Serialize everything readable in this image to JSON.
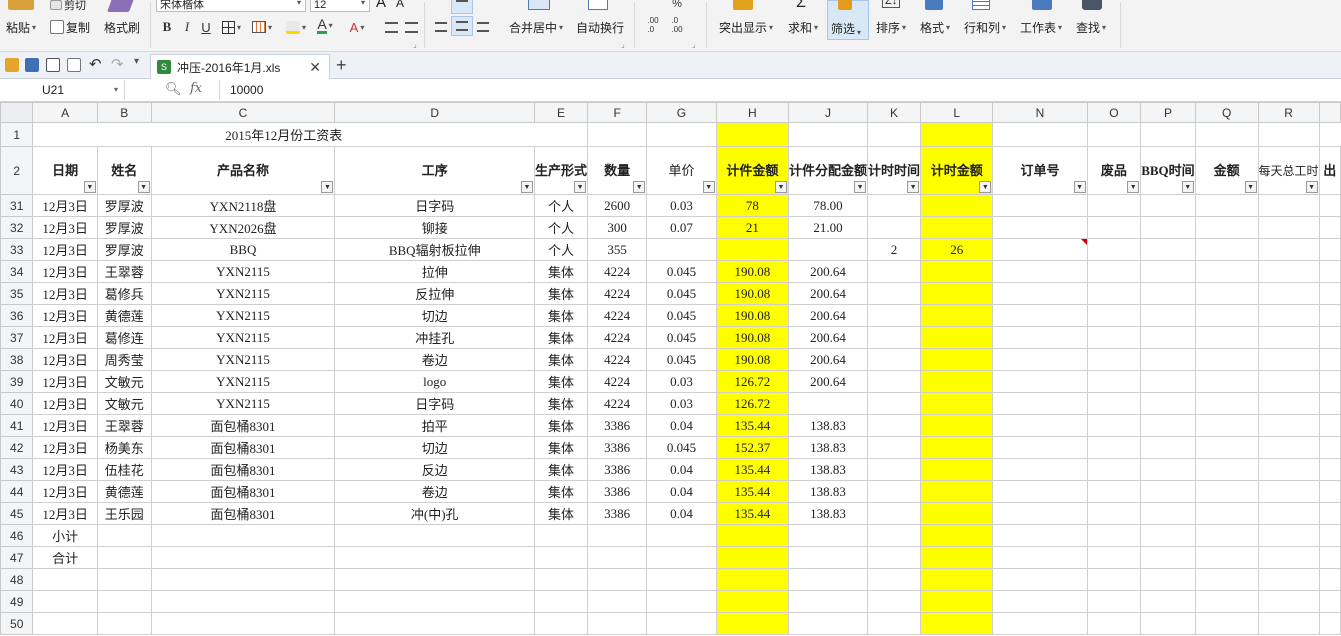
{
  "ribbon": {
    "paste": "粘贴",
    "paste_caret": "▾",
    "copy": "复制",
    "format_painter": "格式刷",
    "cut": "剪切",
    "font_name": "宋体楷体",
    "font_size": "12",
    "bold": "B",
    "italic": "I",
    "underline": "U",
    "font_grow": "A",
    "font_shrink": "A",
    "merge_center": "合并居中",
    "wrap_text": "自动换行",
    "highlight": "突出显示",
    "sum": "求和",
    "filter": "筛选",
    "sort": "排序",
    "format": "格式",
    "rows_cols": "行和列",
    "worksheet": "工作表",
    "find": "查找",
    "percent": "%",
    "decimal_inc": ".00\n.0",
    "decimal_dec": ".0\n.00",
    "dropdown_caret": "▾"
  },
  "tabbar": {
    "doc_name": "冲压-2016年1月.xls",
    "close": "✕",
    "new_tab": "+"
  },
  "formula": {
    "cell_ref": "U21",
    "fx": "fx",
    "value": "10000"
  },
  "columns": [
    "A",
    "B",
    "C",
    "D",
    "E",
    "F",
    "G",
    "H",
    "J",
    "K",
    "L",
    "N",
    "O",
    "P",
    "Q",
    "R",
    ""
  ],
  "title_row": {
    "row": "1",
    "title": "2015年12月份工资表"
  },
  "header_row": {
    "row": "2",
    "cells": [
      "日期",
      "姓名",
      "产品名称",
      "工序",
      "生产形式",
      "数量",
      "单价",
      "计件金额",
      "计件分配金额",
      "计时时间",
      "计时金额",
      "订单号",
      "废品",
      "BBQ时间",
      "金额",
      "每天总工时",
      "出"
    ]
  },
  "rows": [
    {
      "row": "31",
      "date": "12月3日",
      "name": "罗厚波",
      "product": "YXN2118盘",
      "process": "日字码",
      "form": "个人",
      "qty": "2600",
      "price": "0.03",
      "piece": "78",
      "alloc": "78.00",
      "time": "",
      "timepay": ""
    },
    {
      "row": "32",
      "date": "12月3日",
      "name": "罗厚波",
      "product": "YXN2026盘",
      "process": "铆接",
      "form": "个人",
      "qty": "300",
      "price": "0.07",
      "piece": "21",
      "alloc": "21.00",
      "time": "",
      "timepay": ""
    },
    {
      "row": "33",
      "date": "12月3日",
      "name": "罗厚波",
      "product": "BBQ",
      "process": "BBQ辐射板拉伸",
      "form": "个人",
      "qty": "355",
      "price": "",
      "piece": "",
      "alloc": "",
      "time": "2",
      "timepay": "26"
    },
    {
      "row": "34",
      "date": "12月3日",
      "name": "王翠蓉",
      "product": "YXN2115",
      "process": "拉伸",
      "form": "集体",
      "qty": "4224",
      "price": "0.045",
      "piece": "190.08",
      "alloc": "200.64",
      "time": "",
      "timepay": ""
    },
    {
      "row": "35",
      "date": "12月3日",
      "name": "葛修兵",
      "product": "YXN2115",
      "process": "反拉伸",
      "form": "集体",
      "qty": "4224",
      "price": "0.045",
      "piece": "190.08",
      "alloc": "200.64",
      "time": "",
      "timepay": ""
    },
    {
      "row": "36",
      "date": "12月3日",
      "name": "黄德莲",
      "product": "YXN2115",
      "process": "切边",
      "form": "集体",
      "qty": "4224",
      "price": "0.045",
      "piece": "190.08",
      "alloc": "200.64",
      "time": "",
      "timepay": ""
    },
    {
      "row": "37",
      "date": "12月3日",
      "name": "葛修连",
      "product": "YXN2115",
      "process": "冲挂孔",
      "form": "集体",
      "qty": "4224",
      "price": "0.045",
      "piece": "190.08",
      "alloc": "200.64",
      "time": "",
      "timepay": ""
    },
    {
      "row": "38",
      "date": "12月3日",
      "name": "周秀莹",
      "product": "YXN2115",
      "process": "卷边",
      "form": "集体",
      "qty": "4224",
      "price": "0.045",
      "piece": "190.08",
      "alloc": "200.64",
      "time": "",
      "timepay": ""
    },
    {
      "row": "39",
      "date": "12月3日",
      "name": "文敏元",
      "product": "YXN2115",
      "process": "logo",
      "form": "集体",
      "qty": "4224",
      "price": "0.03",
      "piece": "126.72",
      "alloc": "200.64",
      "time": "",
      "timepay": ""
    },
    {
      "row": "40",
      "date": "12月3日",
      "name": "文敏元",
      "product": "YXN2115",
      "process": "日字码",
      "form": "集体",
      "qty": "4224",
      "price": "0.03",
      "piece": "126.72",
      "alloc": "",
      "time": "",
      "timepay": ""
    },
    {
      "row": "41",
      "date": "12月3日",
      "name": "王翠蓉",
      "product": "面包桶8301",
      "process": "拍平",
      "form": "集体",
      "qty": "3386",
      "price": "0.04",
      "piece": "135.44",
      "alloc": "138.83",
      "time": "",
      "timepay": ""
    },
    {
      "row": "42",
      "date": "12月3日",
      "name": "杨美东",
      "product": "面包桶8301",
      "process": "切边",
      "form": "集体",
      "qty": "3386",
      "price": "0.045",
      "piece": "152.37",
      "alloc": "138.83",
      "time": "",
      "timepay": ""
    },
    {
      "row": "43",
      "date": "12月3日",
      "name": "伍桂花",
      "product": "面包桶8301",
      "process": "反边",
      "form": "集体",
      "qty": "3386",
      "price": "0.04",
      "piece": "135.44",
      "alloc": "138.83",
      "time": "",
      "timepay": ""
    },
    {
      "row": "44",
      "date": "12月3日",
      "name": "黄德莲",
      "product": "面包桶8301",
      "process": "卷边",
      "form": "集体",
      "qty": "3386",
      "price": "0.04",
      "piece": "135.44",
      "alloc": "138.83",
      "time": "",
      "timepay": ""
    },
    {
      "row": "45",
      "date": "12月3日",
      "name": "王乐园",
      "product": "面包桶8301",
      "process": "冲(中)孔",
      "form": "集体",
      "qty": "3386",
      "price": "0.04",
      "piece": "135.44",
      "alloc": "138.83",
      "time": "",
      "timepay": ""
    }
  ],
  "summary_rows": [
    {
      "row": "46",
      "label": "小计"
    },
    {
      "row": "47",
      "label": "合计"
    }
  ],
  "empty_rows": [
    "48",
    "49",
    "50"
  ],
  "colors": {
    "highlight_yellow": "#ffff00",
    "header_gray": "#f4f5f7",
    "excel_green": "#2e8b3a"
  }
}
